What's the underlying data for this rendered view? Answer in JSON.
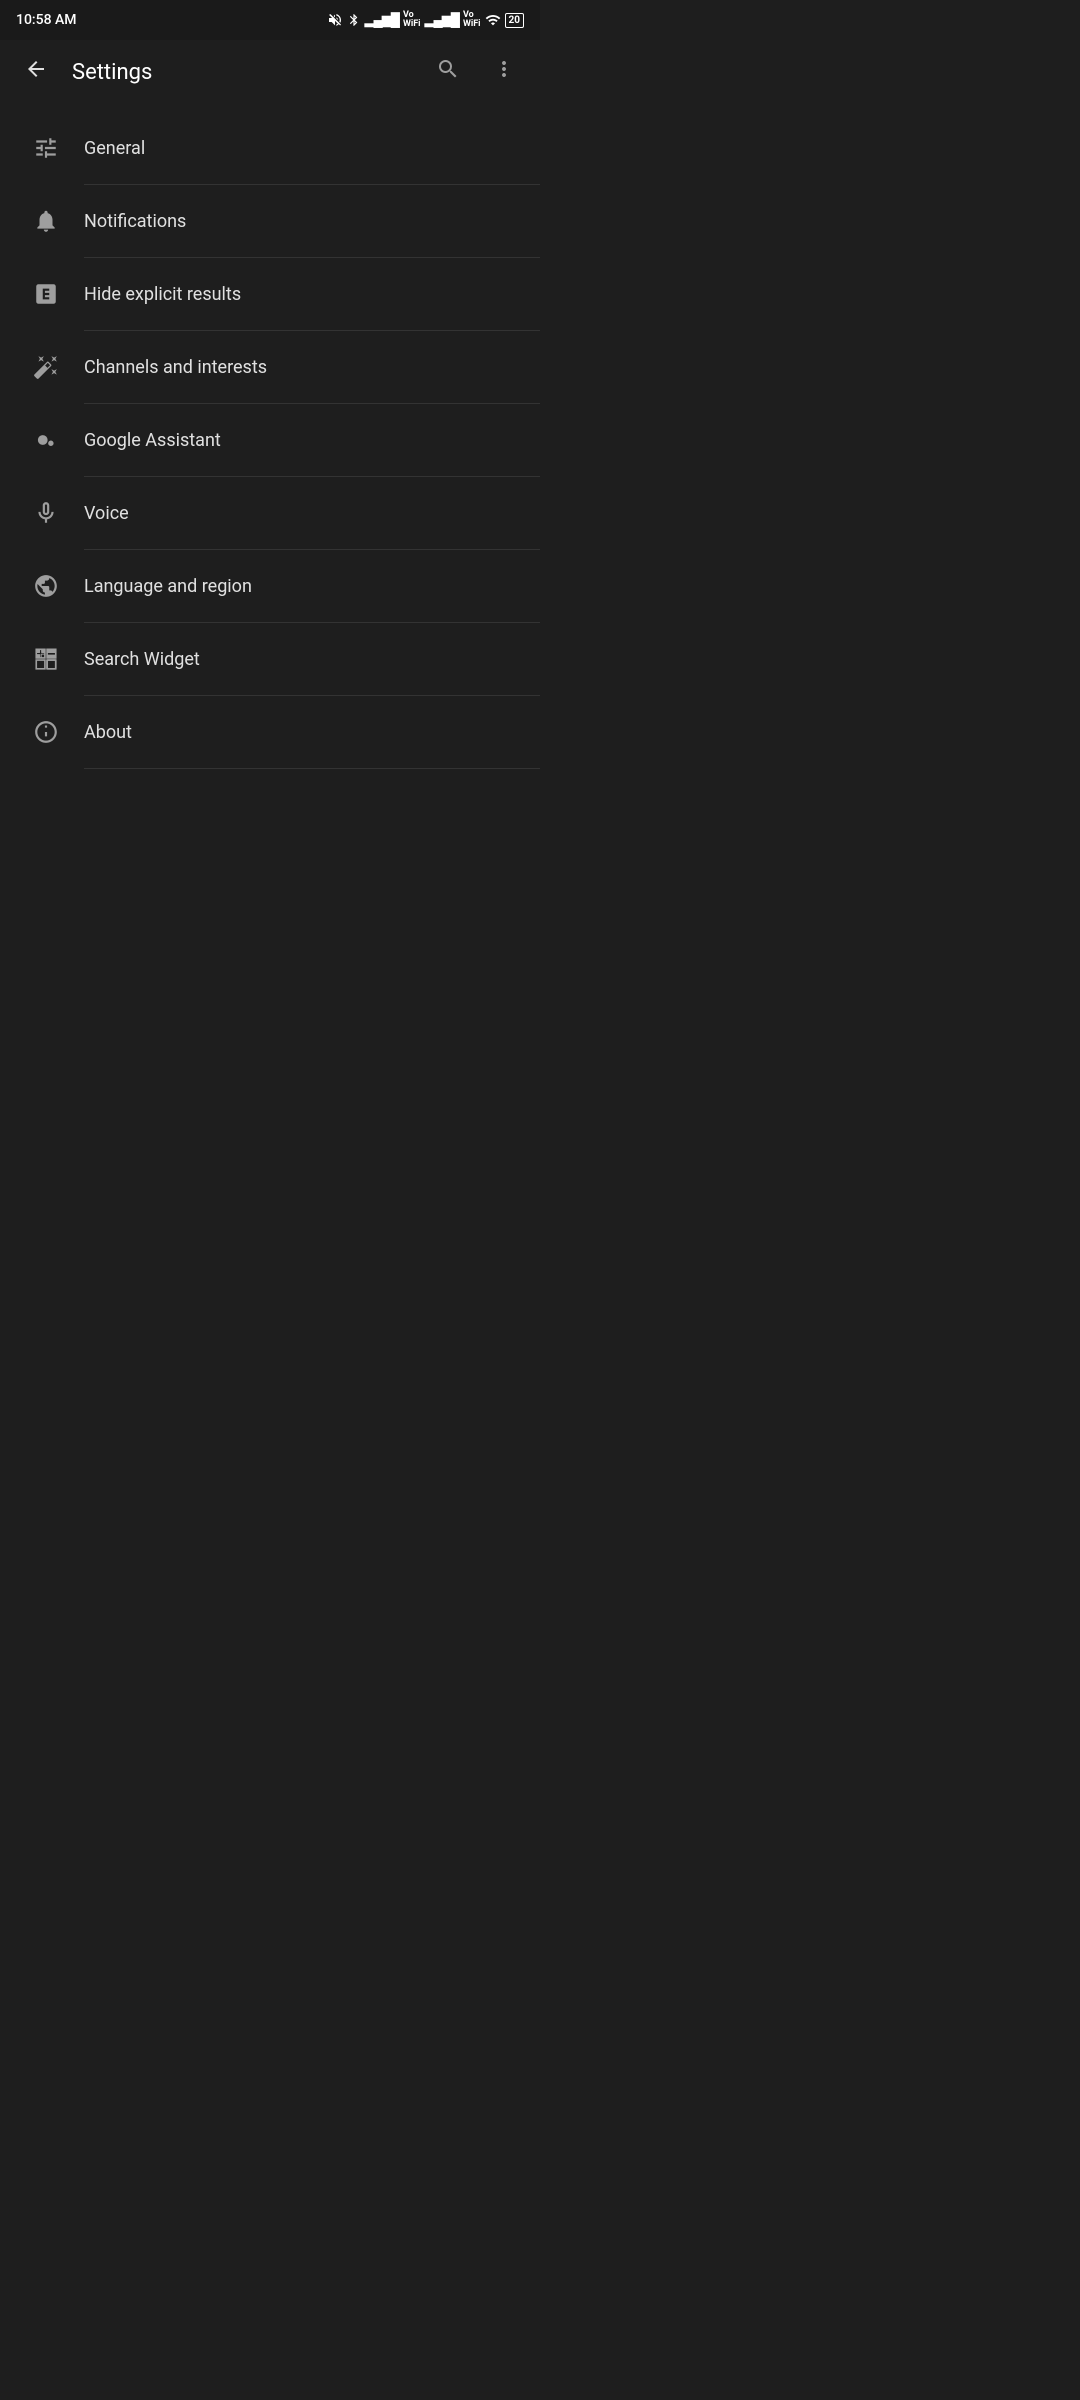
{
  "statusBar": {
    "time": "10:58 AM",
    "batteryLevel": "20"
  },
  "toolbar": {
    "title": "Settings",
    "backLabel": "back",
    "searchLabel": "search",
    "moreLabel": "more options"
  },
  "settingsItems": [
    {
      "id": "general",
      "label": "General",
      "icon": "sliders-icon"
    },
    {
      "id": "notifications",
      "label": "Notifications",
      "icon": "bell-icon"
    },
    {
      "id": "hide-explicit",
      "label": "Hide explicit results",
      "icon": "explicit-icon"
    },
    {
      "id": "channels-interests",
      "label": "Channels and interests",
      "icon": "wand-icon"
    },
    {
      "id": "google-assistant",
      "label": "Google Assistant",
      "icon": "assistant-icon"
    },
    {
      "id": "voice",
      "label": "Voice",
      "icon": "mic-icon"
    },
    {
      "id": "language-region",
      "label": "Language and region",
      "icon": "globe-icon"
    },
    {
      "id": "search-widget",
      "label": "Search Widget",
      "icon": "widget-icon"
    },
    {
      "id": "about",
      "label": "About",
      "icon": "info-icon"
    }
  ]
}
